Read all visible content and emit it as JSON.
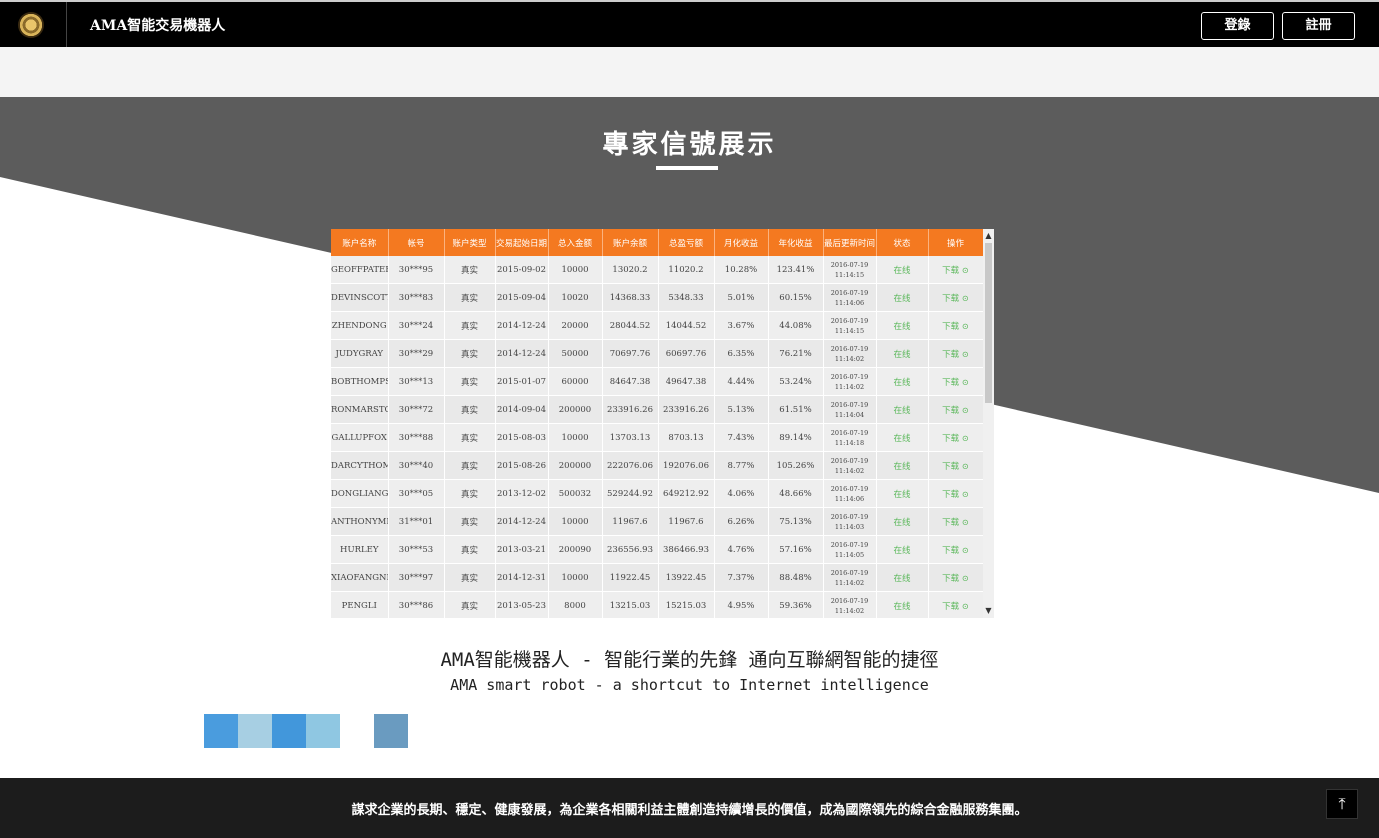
{
  "header": {
    "brand": "AMA智能交易機器人",
    "login_label": "登錄",
    "register_label": "註冊",
    "logo_icon": "gold-emblem-icon"
  },
  "section": {
    "title": "專家信號展示"
  },
  "table": {
    "columns": [
      "账户名称",
      "帐号",
      "账户类型",
      "交易起始日期",
      "总入金额",
      "账户余额",
      "总盈亏额",
      "月化收益",
      "年化收益",
      "最后更新时间",
      "状态",
      "操作"
    ],
    "rows": [
      [
        "GEOFFPATERSON",
        "30***95",
        "真实",
        "2015-09-02",
        "10000",
        "13020.2",
        "11020.2",
        "10.28%",
        "123.41%",
        "2016-07-19",
        "11:14:15",
        "在线",
        "下载"
      ],
      [
        "DEVINSCOTT",
        "30***83",
        "真实",
        "2015-09-04",
        "10020",
        "14368.33",
        "5348.33",
        "5.01%",
        "60.15%",
        "2016-07-19",
        "11:14:06",
        "在线",
        "下载"
      ],
      [
        "ZHENDONG",
        "30***24",
        "真实",
        "2014-12-24",
        "20000",
        "28044.52",
        "14044.52",
        "3.67%",
        "44.08%",
        "2016-07-19",
        "11:14:15",
        "在线",
        "下载"
      ],
      [
        "JUDYGRAY",
        "30***29",
        "真实",
        "2014-12-24",
        "50000",
        "70697.76",
        "60697.76",
        "6.35%",
        "76.21%",
        "2016-07-19",
        "11:14:02",
        "在线",
        "下载"
      ],
      [
        "BOBTHOMPSON",
        "30***13",
        "真实",
        "2015-01-07",
        "60000",
        "84647.38",
        "49647.38",
        "4.44%",
        "53.24%",
        "2016-07-19",
        "11:14:02",
        "在线",
        "下载"
      ],
      [
        "RONMARSTON",
        "30***72",
        "真实",
        "2014-09-04",
        "200000",
        "233916.26",
        "233916.26",
        "5.13%",
        "61.51%",
        "2016-07-19",
        "11:14:04",
        "在线",
        "下载"
      ],
      [
        "GALLUPFOX",
        "30***88",
        "真实",
        "2015-08-03",
        "10000",
        "13703.13",
        "8703.13",
        "7.43%",
        "89.14%",
        "2016-07-19",
        "11:14:18",
        "在线",
        "下载"
      ],
      [
        "DARCYTHOMPSON",
        "30***40",
        "真实",
        "2015-08-26",
        "200000",
        "222076.06",
        "192076.06",
        "8.77%",
        "105.26%",
        "2016-07-19",
        "11:14:02",
        "在线",
        "下载"
      ],
      [
        "DONGLIANGXU",
        "30***05",
        "真实",
        "2013-12-02",
        "500032",
        "529244.92",
        "649212.92",
        "4.06%",
        "48.66%",
        "2016-07-19",
        "11:14:06",
        "在线",
        "下载"
      ],
      [
        "ANTHONYMILLER",
        "31***01",
        "真实",
        "2014-12-24",
        "10000",
        "11967.6",
        "11967.6",
        "6.26%",
        "75.13%",
        "2016-07-19",
        "11:14:03",
        "在线",
        "下载"
      ],
      [
        "HURLEY",
        "30***53",
        "真实",
        "2013-03-21",
        "200090",
        "236556.93",
        "386466.93",
        "4.76%",
        "57.16%",
        "2016-07-19",
        "11:14:05",
        "在线",
        "下载"
      ],
      [
        "XIAOFANGNIE",
        "30***97",
        "真实",
        "2014-12-31",
        "10000",
        "11922.45",
        "13922.45",
        "7.37%",
        "88.48%",
        "2016-07-19",
        "11:14:02",
        "在线",
        "下载"
      ],
      [
        "PENGLI",
        "30***86",
        "真实",
        "2013-05-23",
        "8000",
        "13215.03",
        "15215.03",
        "4.95%",
        "59.36%",
        "2016-07-19",
        "11:14:02",
        "在线",
        "下载"
      ]
    ]
  },
  "tagline": {
    "zh": "AMA智能機器人 - 智能行業的先鋒 通向互聯網智能的捷徑",
    "en": "AMA smart robot - a shortcut to Internet intelligence"
  },
  "swatches": [
    "#4a9cde",
    "#a7cfe3",
    "#4297db",
    "#8fc7e2",
    "#ffffff",
    "#6a9bc0"
  ],
  "footer": {
    "text": "謀求企業的長期、穩定、健康發展，為企業各相關利益主體創造持續增長的價值，成為國際領先的綜合金融服務集團。",
    "totop_icon": "arrow-up-to-top-icon"
  },
  "colors": {
    "header_bg": "#000000",
    "table_header": "#f47920",
    "band_dark": "#5c5c5c",
    "status_green": "#5cb85c",
    "footer_bg": "#1c1c1c"
  }
}
